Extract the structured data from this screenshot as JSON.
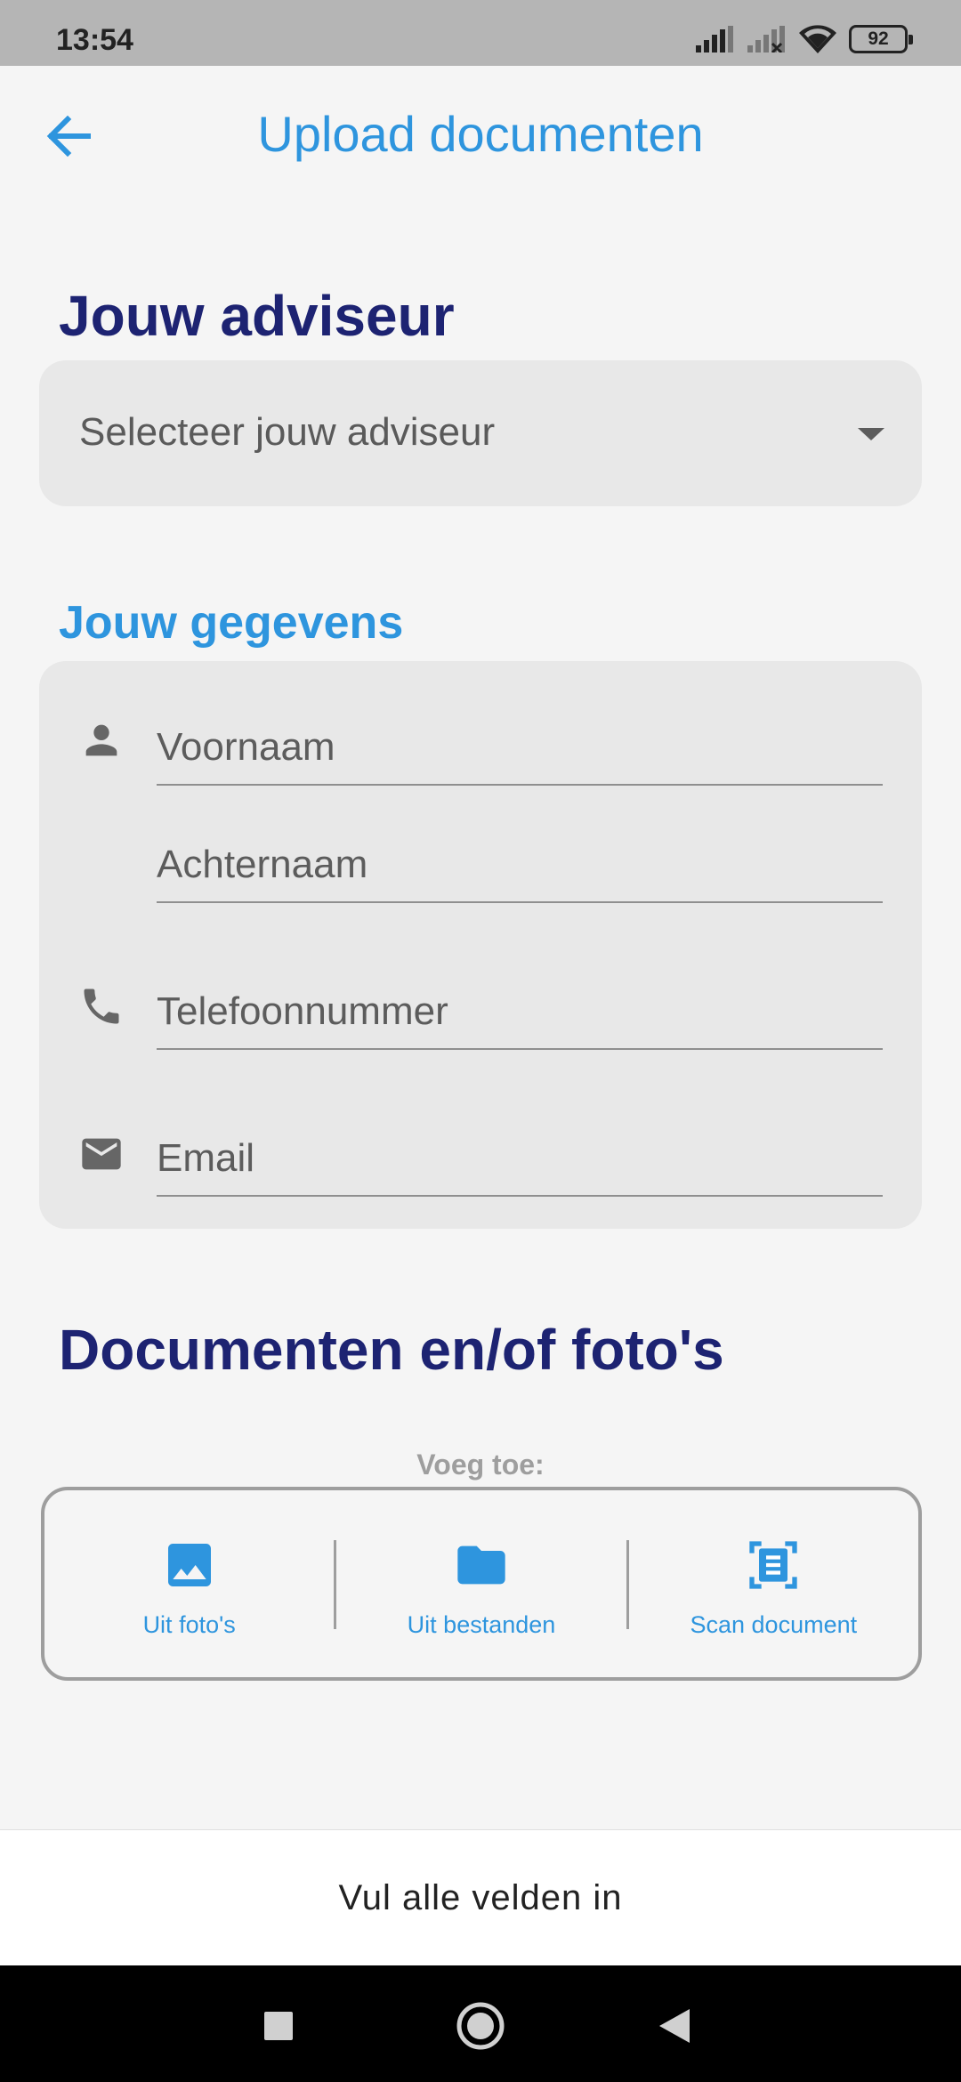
{
  "status_bar": {
    "time": "13:54",
    "battery": "92"
  },
  "app_bar": {
    "title": "Upload documenten",
    "back_icon": "arrow-back-icon"
  },
  "adviser_section": {
    "title": "Jouw adviseur",
    "select_placeholder": "Selecteer jouw adviseur"
  },
  "details_section": {
    "title": "Jouw gegevens",
    "fields": [
      {
        "placeholder": "Voornaam",
        "icon": "person-icon"
      },
      {
        "placeholder": "Achternaam"
      },
      {
        "placeholder": "Telefoonnummer",
        "icon": "phone-icon"
      },
      {
        "placeholder": "Email",
        "icon": "mail-icon"
      }
    ]
  },
  "documents_section": {
    "title": "Documenten en/of foto's",
    "add_label": "Voeg toe:",
    "options": [
      {
        "label": "Uit foto's",
        "icon": "image-icon"
      },
      {
        "label": "Uit bestanden",
        "icon": "folder-icon"
      },
      {
        "label": "Scan document",
        "icon": "document-scanner-icon"
      }
    ]
  },
  "submit_button": {
    "label": "Vul alle velden in"
  },
  "colors": {
    "accent": "#2e95de",
    "heading": "#1d2372",
    "field_bg": "#e8e8e8"
  }
}
